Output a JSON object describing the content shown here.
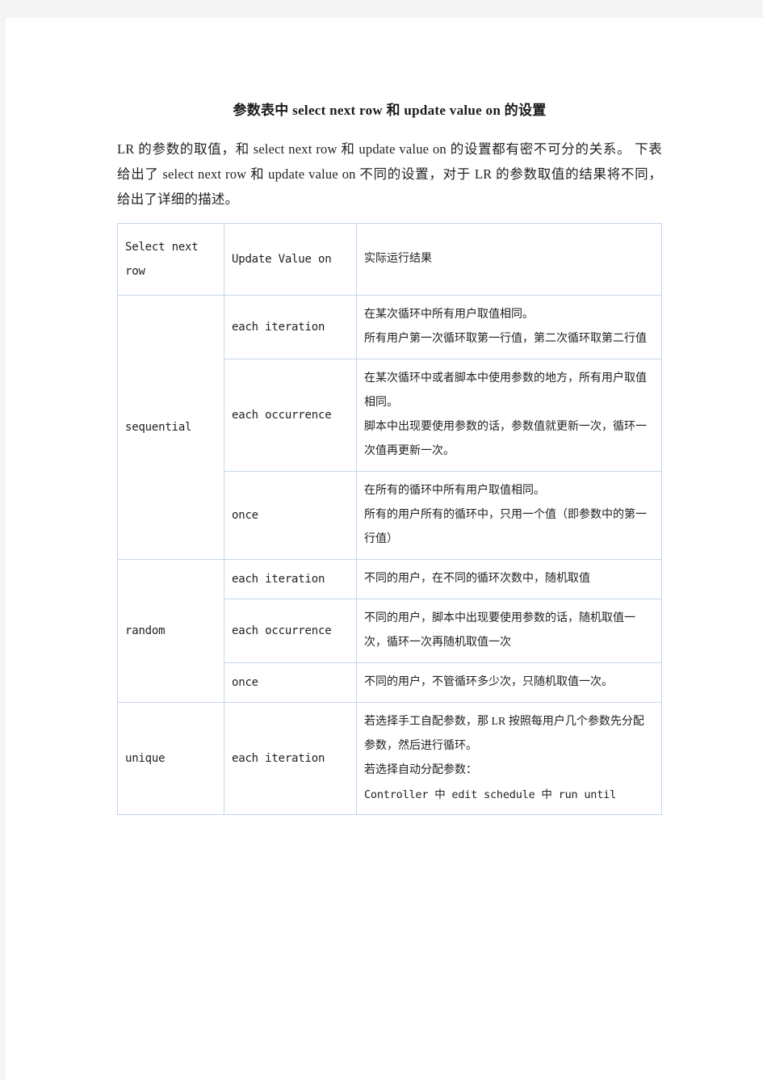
{
  "document": {
    "title": "参数表中 select next row 和 update value on 的设置",
    "intro": "LR 的参数的取值，和 select next row 和 update value on 的设置都有密不可分的关系。 下表给出了 select next row 和 update value on 不同的设置，对于 LR 的参数取值的结果将不同，给出了详细的描述。"
  },
  "table": {
    "headers": {
      "col1": "Select next row",
      "col2": "Update Value on",
      "col3": "实际运行结果"
    },
    "groups": [
      {
        "name": "sequential",
        "rows": [
          {
            "option": "each iteration",
            "lines": [
              "在某次循环中所有用户取值相同。",
              "所有用户第一次循环取第一行值，第二次循环取第二行值"
            ]
          },
          {
            "option": "each occurrence",
            "lines": [
              "在某次循环中或者脚本中使用参数的地方，所有用户取值相同。",
              "脚本中出现要使用参数的话，参数值就更新一次，循环一次值再更新一次。"
            ]
          },
          {
            "option": "once",
            "lines": [
              "在所有的循环中所有用户取值相同。",
              "所有的用户所有的循环中，只用一个值（即参数中的第一行值）"
            ]
          }
        ]
      },
      {
        "name": "random",
        "rows": [
          {
            "option": "each iteration",
            "lines": [
              "不同的用户，在不同的循环次数中，随机取值"
            ]
          },
          {
            "option": "each occurrence",
            "lines": [
              "不同的用户，脚本中出现要使用参数的话，随机取值一次，循环一次再随机取值一次"
            ]
          },
          {
            "option": "once",
            "lines": [
              "不同的用户，不管循环多少次，只随机取值一次。"
            ]
          }
        ]
      },
      {
        "name": "unique",
        "rows": [
          {
            "option": "each iteration",
            "lines": [
              "若选择手工自配参数，那 LR 按照每用户几个参数先分配参数，然后进行循环。",
              "若选择自动分配参数："
            ],
            "mono_lines": [
              "Controller 中 edit schedule 中 run until"
            ]
          }
        ]
      }
    ]
  },
  "colors": {
    "border": "#c8d7e8",
    "page_bg": "#ffffff",
    "canvas_bg": "#f4f4f4",
    "text": "#1f1f1f"
  }
}
